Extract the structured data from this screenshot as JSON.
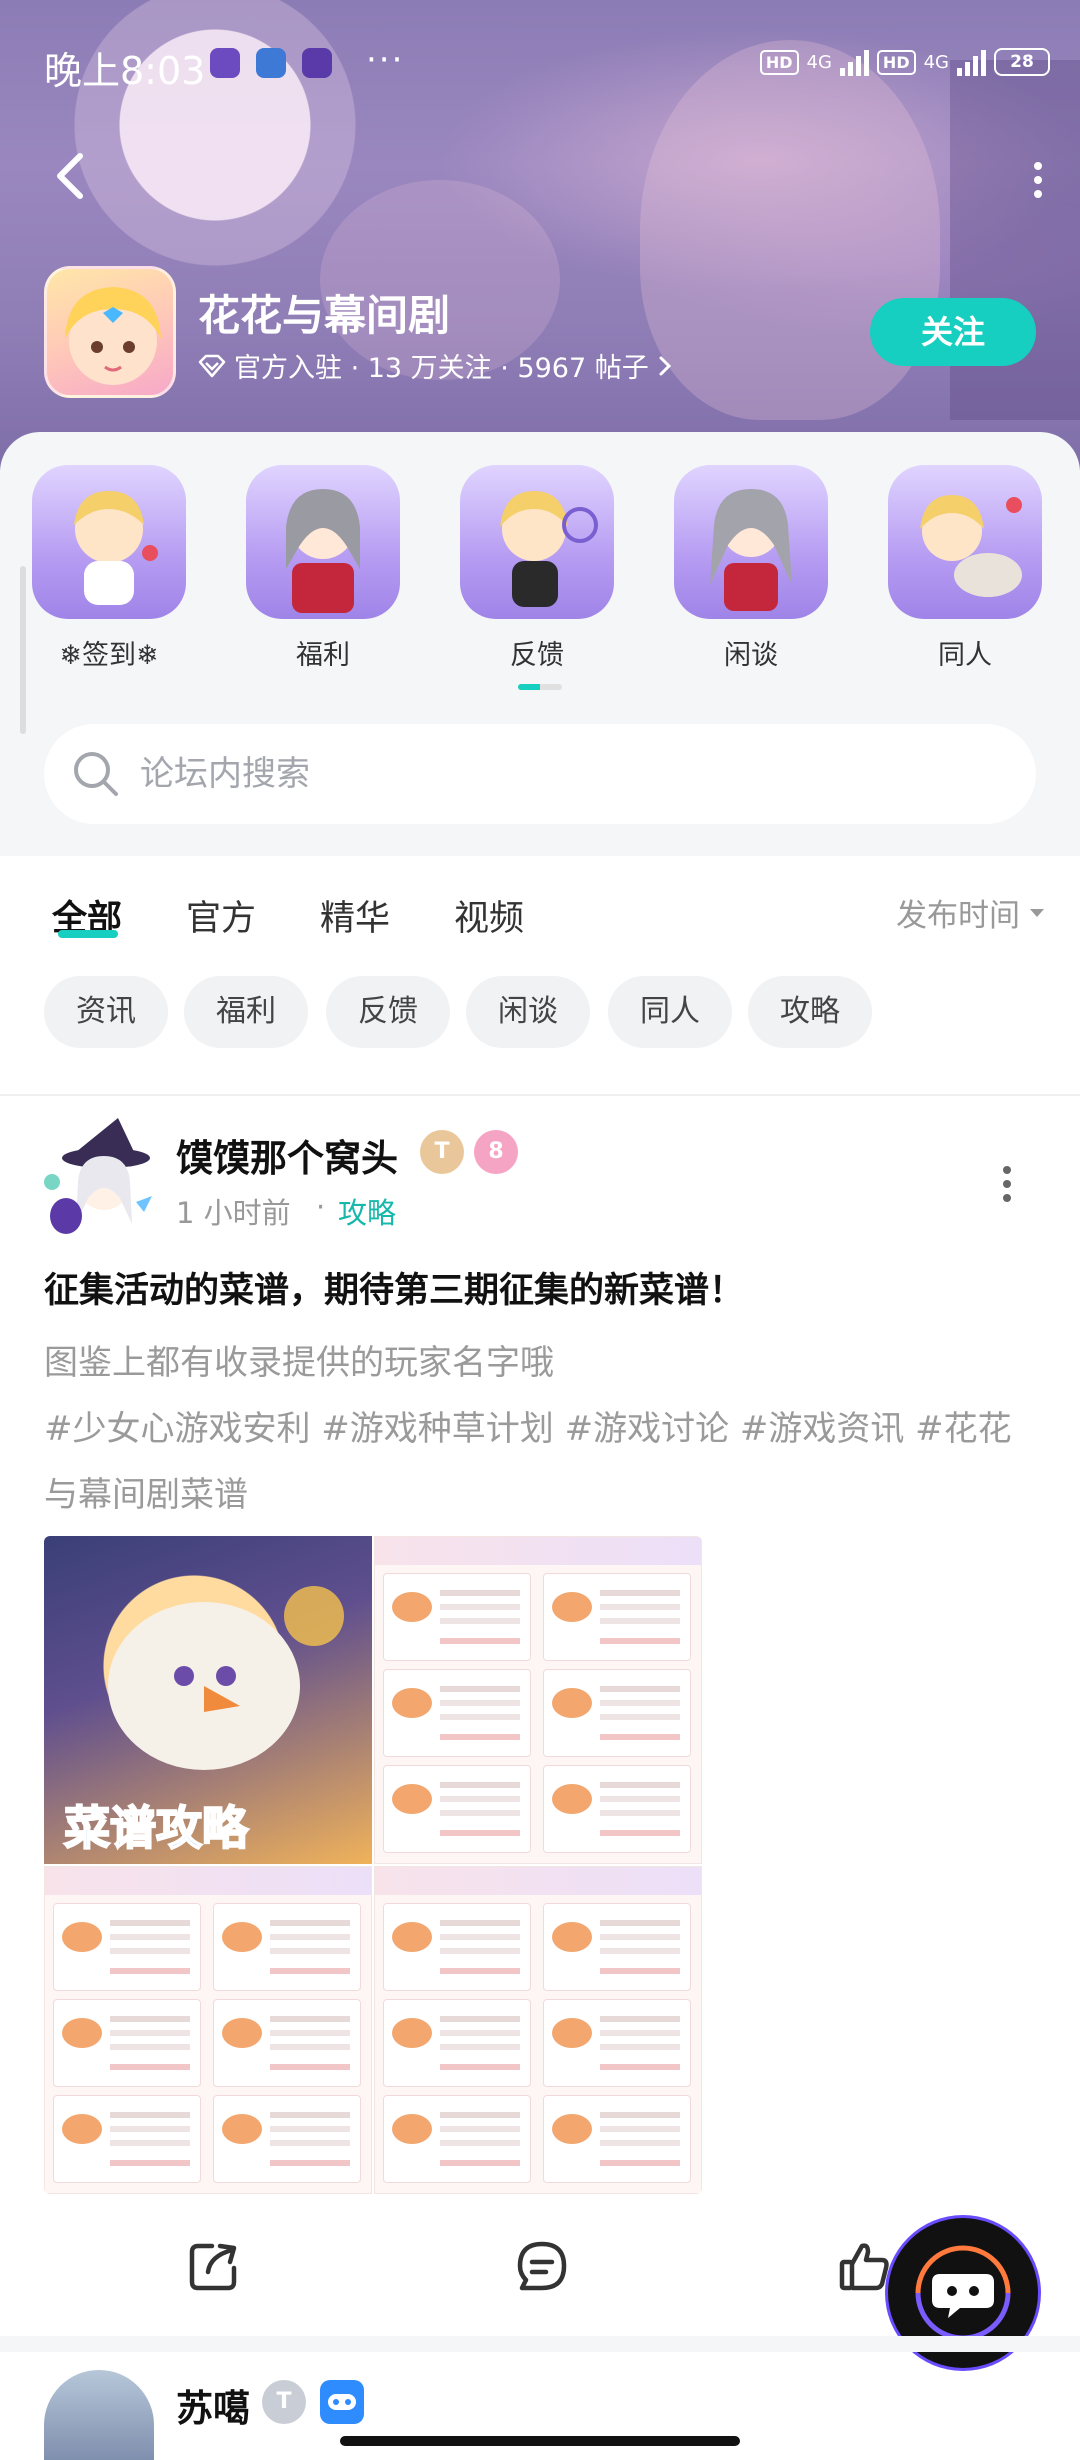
{
  "status_bar": {
    "time": "晚上8:03",
    "more_dots": "···",
    "hd_label": "HD",
    "network": "4G",
    "battery": "28"
  },
  "header": {
    "forum_name": "花花与幕间剧",
    "meta": "官方入驻 · 13 万关注 · 5967 帖子",
    "follow_label": "关注"
  },
  "channels": [
    {
      "label": "❄签到❄"
    },
    {
      "label": "福利"
    },
    {
      "label": "反馈"
    },
    {
      "label": "闲谈"
    },
    {
      "label": "同人"
    }
  ],
  "search": {
    "placeholder": "论坛内搜索"
  },
  "tabs": [
    {
      "label": "全部",
      "active": true
    },
    {
      "label": "官方"
    },
    {
      "label": "精华"
    },
    {
      "label": "视频"
    }
  ],
  "sort_label": "发布时间",
  "chips": [
    "资讯",
    "福利",
    "反馈",
    "闲谈",
    "同人",
    "攻略"
  ],
  "post": {
    "author": "馍馍那个窝头",
    "level_badge": "T",
    "level_number": "8",
    "time": "1 小时前",
    "separator": "·",
    "category": "攻略",
    "title": "征集活动的菜谱，期待第三期征集的新菜谱！",
    "body": "图鉴上都有收录提供的玩家名字哦",
    "tags": "#少女心游戏安利 #游戏种草计划 #游戏讨论 #游戏资讯 #花花与幕间剧菜谱",
    "image_text": "菜谱攻略"
  },
  "next_post": {
    "author": "苏噶",
    "level_badge": "T"
  },
  "colors": {
    "accent": "#17cfc0",
    "category_text": "#17b8ab"
  }
}
